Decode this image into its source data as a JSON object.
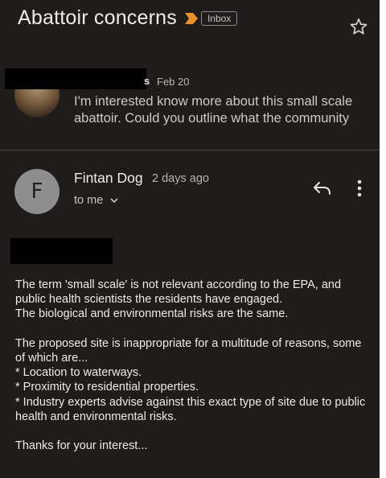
{
  "header": {
    "subject": "Abattoir concerns",
    "label": "Inbox"
  },
  "collapsed_message": {
    "sender_visible_tail": "s",
    "date": "Feb 20",
    "snippet": "I'm interested know more about this small scale abattoir. Could you outline what the community"
  },
  "message": {
    "avatar_letter": "F",
    "sender": "Fintan Dog",
    "time": "2 days ago",
    "recipient": "to me",
    "body": [
      "The term 'small scale' is not relevant according to the EPA, and public health scientists the residents have engaged.",
      "The biological and environmental risks are the same.",
      "",
      "The proposed site is inappropriate for a multitude of reasons, some of which are...",
      "* Location to waterways.",
      "* Proximity to residential properties.",
      "* Industry experts advise against this exact type of site due to public health and environmental risks.",
      "",
      "Thanks for your interest..."
    ]
  },
  "colors": {
    "background": "#201c1b",
    "importance_marker": "#e8912d",
    "avatar_bg": "#8e8e8e"
  },
  "icons": [
    "importance-marker-icon",
    "star-icon",
    "chevron-down-icon",
    "reply-icon",
    "more-vert-icon"
  ]
}
